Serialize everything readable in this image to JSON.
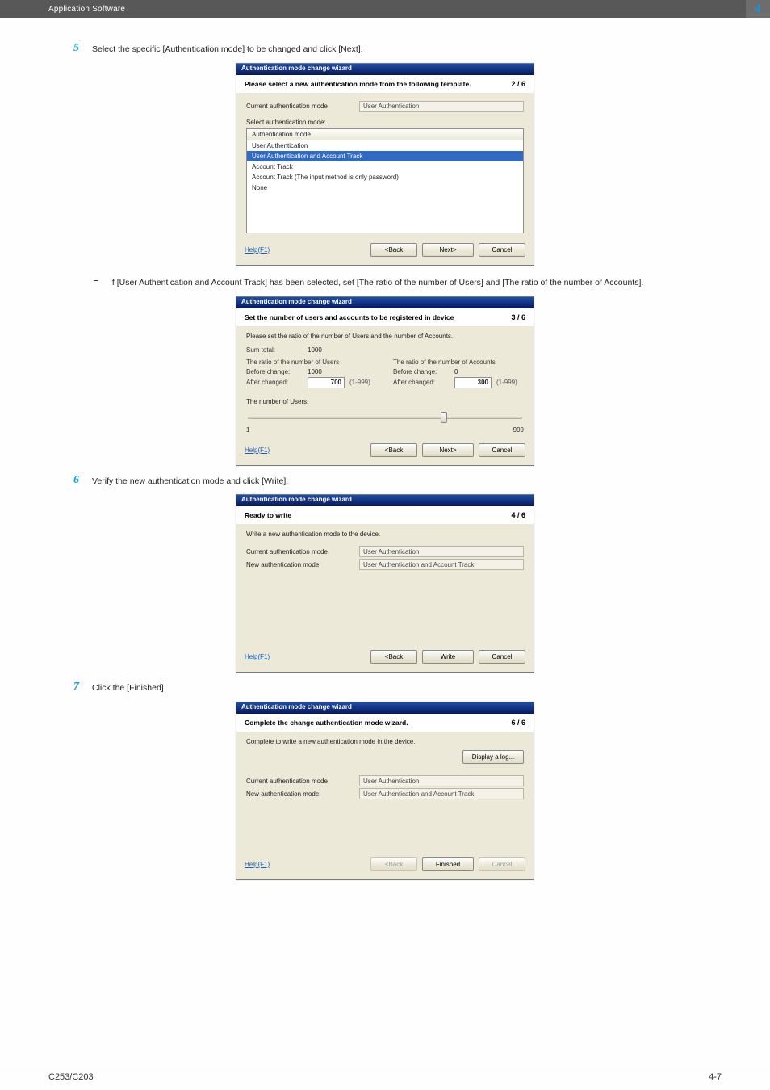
{
  "header": {
    "section_title": "Application Software",
    "chapter_number": "4"
  },
  "steps": {
    "s5": {
      "num": "5",
      "text": "Select the specific [Authentication mode] to be changed and click [Next]."
    },
    "s5a": {
      "dash": "–",
      "text": "If [User Authentication and Account Track] has been selected, set [The ratio of the number of Users] and [The ratio of the number of Accounts]."
    },
    "s6": {
      "num": "6",
      "text": "Verify the new authentication mode and click [Write]."
    },
    "s7": {
      "num": "7",
      "text": "Click the [Finished]."
    }
  },
  "wiz_common": {
    "titlebar": "Authentication mode change wizard",
    "help": "Help(F1)",
    "back": "<Back",
    "next": "Next>",
    "write": "Write",
    "finished": "Finished",
    "cancel": "Cancel"
  },
  "wiz2": {
    "header": "Please select a new authentication mode from the following template.",
    "pager": "2 / 6",
    "current_lbl": "Current authentication mode",
    "current_val": "User Authentication",
    "select_lbl": "Select authentication mode:",
    "col_hdr": "Authentication mode",
    "rows": [
      "User Authentication",
      "User Authentication and Account Track",
      "Account Track",
      "Account Track (The input method is only password)",
      "None"
    ]
  },
  "wiz3": {
    "header": "Set the number of users and accounts to be registered in device",
    "pager": "3 / 6",
    "note": "Please set the ratio of the number of Users and the number of Accounts.",
    "sum_lbl": "Sum total:",
    "sum_val": "1000",
    "users_hd": "The ratio of the number of Users",
    "accts_hd": "The ratio of the number of Accounts",
    "before_lbl": "Before change:",
    "after_lbl": "After changed:",
    "users_before": "1000",
    "users_after": "700",
    "accts_before": "0",
    "accts_after": "300",
    "range": "(1-999)",
    "slider_caption": "The number of Users:",
    "slider_min": "1",
    "slider_max": "999"
  },
  "wiz4": {
    "header": "Ready to write",
    "pager": "4 / 6",
    "note": "Write a new authentication mode to the device.",
    "cur_lbl": "Current authentication mode",
    "new_lbl": "New authentication mode",
    "cur_val": "User Authentication",
    "new_val": "User Authentication and Account Track"
  },
  "wiz6": {
    "header": "Complete the change authentication mode wizard.",
    "pager": "6 / 6",
    "note": "Complete to write a new authentication mode in the device.",
    "log_btn": "Display a log...",
    "cur_lbl": "Current authentication mode",
    "new_lbl": "New authentication mode",
    "cur_val": "User Authentication",
    "new_val": "User Authentication and Account Track"
  },
  "footer": {
    "left": "C253/C203",
    "right": "4-7"
  }
}
